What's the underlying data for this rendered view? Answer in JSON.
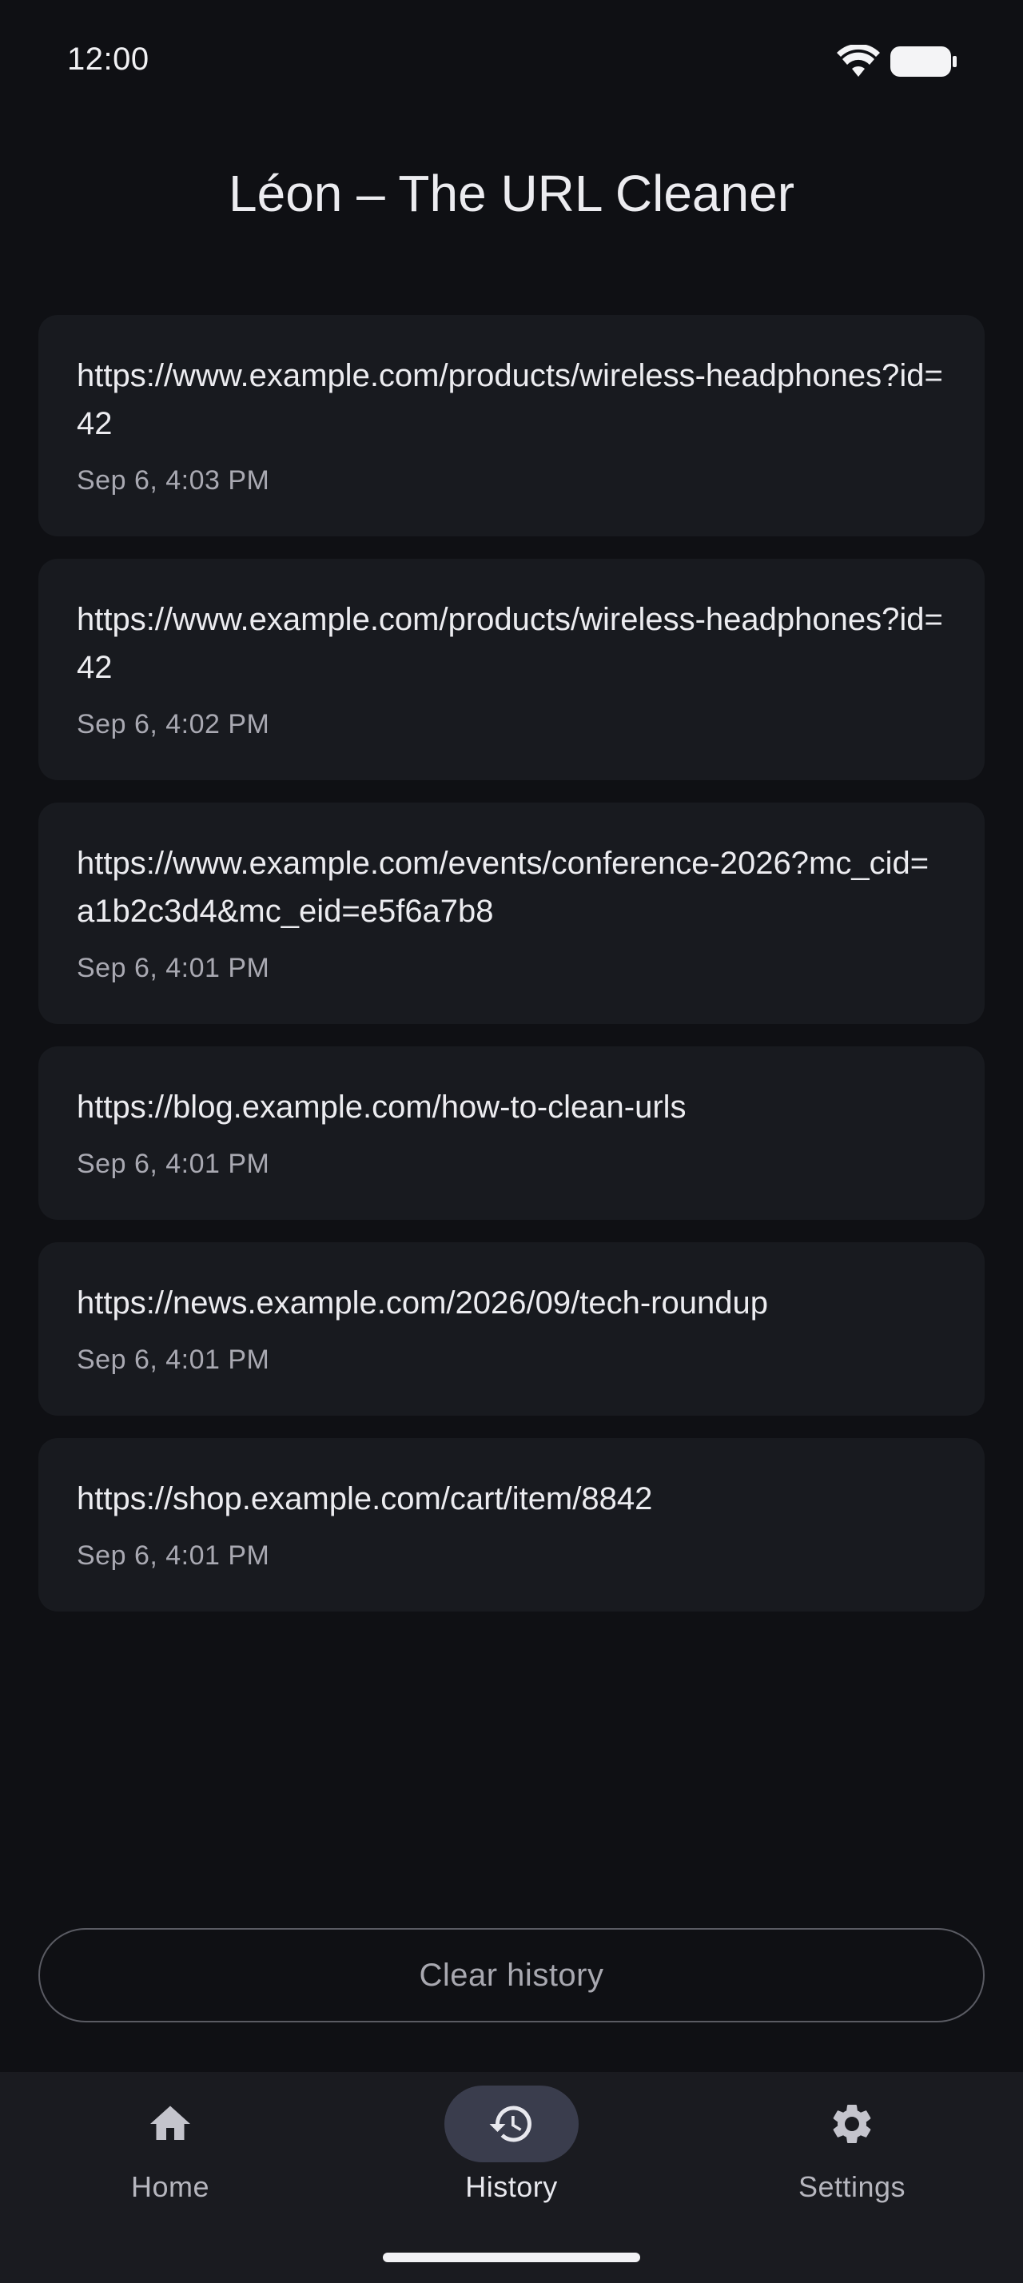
{
  "status_bar": {
    "time": "12:00",
    "wifi_icon": "wifi-icon",
    "battery_icon": "battery-icon"
  },
  "app": {
    "title": "Léon – The URL Cleaner"
  },
  "history": {
    "items": [
      {
        "url": "https://www.example.com/products/wireless-headphones?id=42",
        "time": "Sep 6, 4:03 PM"
      },
      {
        "url": "https://www.example.com/products/wireless-headphones?id=42",
        "time": "Sep 6, 4:02 PM"
      },
      {
        "url": "https://www.example.com/events/conference-2026?mc_cid=a1b2c3d4&mc_eid=e5f6a7b8",
        "time": "Sep 6, 4:01 PM"
      },
      {
        "url": "https://blog.example.com/how-to-clean-urls",
        "time": "Sep 6, 4:01 PM"
      },
      {
        "url": "https://news.example.com/2026/09/tech-roundup",
        "time": "Sep 6, 4:01 PM"
      },
      {
        "url": "https://shop.example.com/cart/item/8842",
        "time": "Sep 6, 4:01 PM"
      }
    ]
  },
  "actions": {
    "clear_history_label": "Clear history"
  },
  "bottom_nav": {
    "items": [
      {
        "label": "Home",
        "icon": "home-icon",
        "active": false
      },
      {
        "label": "History",
        "icon": "history-icon",
        "active": true
      },
      {
        "label": "Settings",
        "icon": "gear-icon",
        "active": false
      }
    ]
  },
  "colors": {
    "background": "#0f1014",
    "card": "#181a1f",
    "active_pill": "#3a3d4d",
    "nav_bar": "#1a1b20"
  }
}
